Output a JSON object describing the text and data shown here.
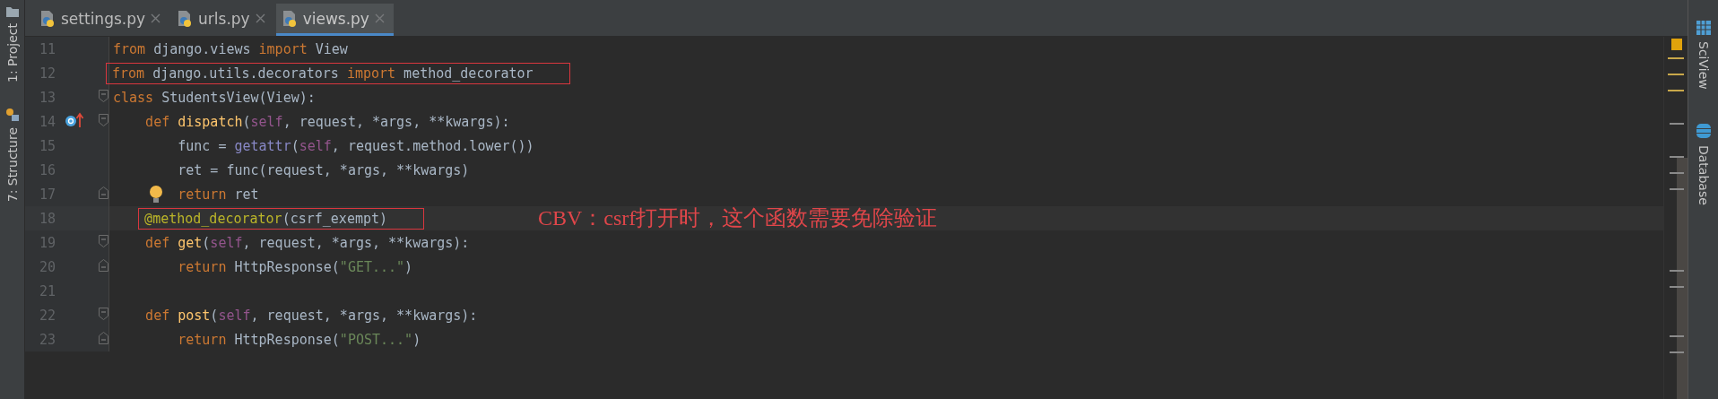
{
  "left_tools": [
    {
      "label": "1: Project",
      "kind": "project"
    },
    {
      "label": "7: Structure",
      "kind": "structure"
    }
  ],
  "tabs": [
    {
      "label": "settings.py",
      "selected": false
    },
    {
      "label": "urls.py",
      "selected": false
    },
    {
      "label": "views.py",
      "selected": true
    }
  ],
  "editor": {
    "lines": [
      {
        "number": "11",
        "current": false,
        "boxed": false,
        "tokens": [
          {
            "t": "from",
            "kind": "kw"
          },
          {
            "t": " django.views ",
            "kind": "id"
          },
          {
            "t": "import",
            "kind": "kw"
          },
          {
            "t": " View",
            "kind": "id"
          }
        ]
      },
      {
        "number": "12",
        "current": false,
        "boxed": true,
        "tokens": [
          {
            "t": "from",
            "kind": "kw"
          },
          {
            "t": " django.utils.decorators ",
            "kind": "id"
          },
          {
            "t": "import",
            "kind": "kw"
          },
          {
            "t": " method_decorator",
            "kind": "id"
          }
        ]
      },
      {
        "number": "13",
        "current": false,
        "boxed": false,
        "fold_start": true,
        "tokens": [
          {
            "t": "class",
            "kind": "kw"
          },
          {
            "t": " StudentsView(View):",
            "kind": "id"
          }
        ]
      },
      {
        "number": "14",
        "current": false,
        "boxed": false,
        "fold_start": true,
        "overrides": true,
        "tokens": [
          {
            "t": "    def",
            "kind": "kw"
          },
          {
            "t": " dispatch",
            "kind": "fn"
          },
          {
            "t": "(",
            "kind": "id"
          },
          {
            "t": "self",
            "kind": "self"
          },
          {
            "t": ", request, *args, **kwargs):",
            "kind": "id"
          }
        ]
      },
      {
        "number": "15",
        "current": false,
        "boxed": false,
        "tokens": [
          {
            "t": "        func = ",
            "kind": "id"
          },
          {
            "t": "getattr",
            "kind": "builtin"
          },
          {
            "t": "(",
            "kind": "id"
          },
          {
            "t": "self",
            "kind": "self"
          },
          {
            "t": ", request.method.lower())",
            "kind": "id"
          }
        ]
      },
      {
        "number": "16",
        "current": false,
        "boxed": false,
        "tokens": [
          {
            "t": "        ret = func(request, *args, **kwargs)",
            "kind": "id"
          }
        ]
      },
      {
        "number": "17",
        "current": false,
        "boxed": false,
        "fold_end": true,
        "intention": true,
        "tokens": [
          {
            "t": "        return",
            "kind": "kw"
          },
          {
            "t": " ret",
            "kind": "id"
          }
        ]
      },
      {
        "number": "18",
        "current": true,
        "boxed": true,
        "note": "CBV：csrf打开时，这个函数需要免除验证",
        "tokens": [
          {
            "t": "    @method_decorator",
            "kind": "deco"
          },
          {
            "t": "(csrf_exempt)",
            "kind": "id"
          }
        ]
      },
      {
        "number": "19",
        "current": false,
        "boxed": false,
        "fold_start": true,
        "tokens": [
          {
            "t": "    def",
            "kind": "kw"
          },
          {
            "t": " get",
            "kind": "fn"
          },
          {
            "t": "(",
            "kind": "id"
          },
          {
            "t": "self",
            "kind": "self"
          },
          {
            "t": ", request, *args, **kwargs):",
            "kind": "id"
          }
        ]
      },
      {
        "number": "20",
        "current": false,
        "boxed": false,
        "fold_end": true,
        "tokens": [
          {
            "t": "        return",
            "kind": "kw"
          },
          {
            "t": " HttpResponse(",
            "kind": "id"
          },
          {
            "t": "\"GET...\"",
            "kind": "str"
          },
          {
            "t": ")",
            "kind": "id"
          }
        ]
      },
      {
        "number": "21",
        "current": false,
        "boxed": false
      },
      {
        "number": "22",
        "current": false,
        "boxed": false,
        "fold_start": true,
        "tokens": [
          {
            "t": "    def",
            "kind": "kw"
          },
          {
            "t": " post",
            "kind": "fn"
          },
          {
            "t": "(",
            "kind": "id"
          },
          {
            "t": "self",
            "kind": "self"
          },
          {
            "t": ", request, *args, **kwargs):",
            "kind": "id"
          }
        ]
      },
      {
        "number": "23",
        "current": false,
        "boxed": false,
        "fold_end": true,
        "tokens": [
          {
            "t": "        return",
            "kind": "kw"
          },
          {
            "t": " HttpResponse(",
            "kind": "id"
          },
          {
            "t": "\"POST...\"",
            "kind": "str"
          },
          {
            "t": ")",
            "kind": "id"
          }
        ]
      }
    ]
  },
  "right_tools": [
    {
      "label": "SciView",
      "kind": "grid"
    },
    {
      "label": "Database",
      "kind": "database"
    }
  ]
}
